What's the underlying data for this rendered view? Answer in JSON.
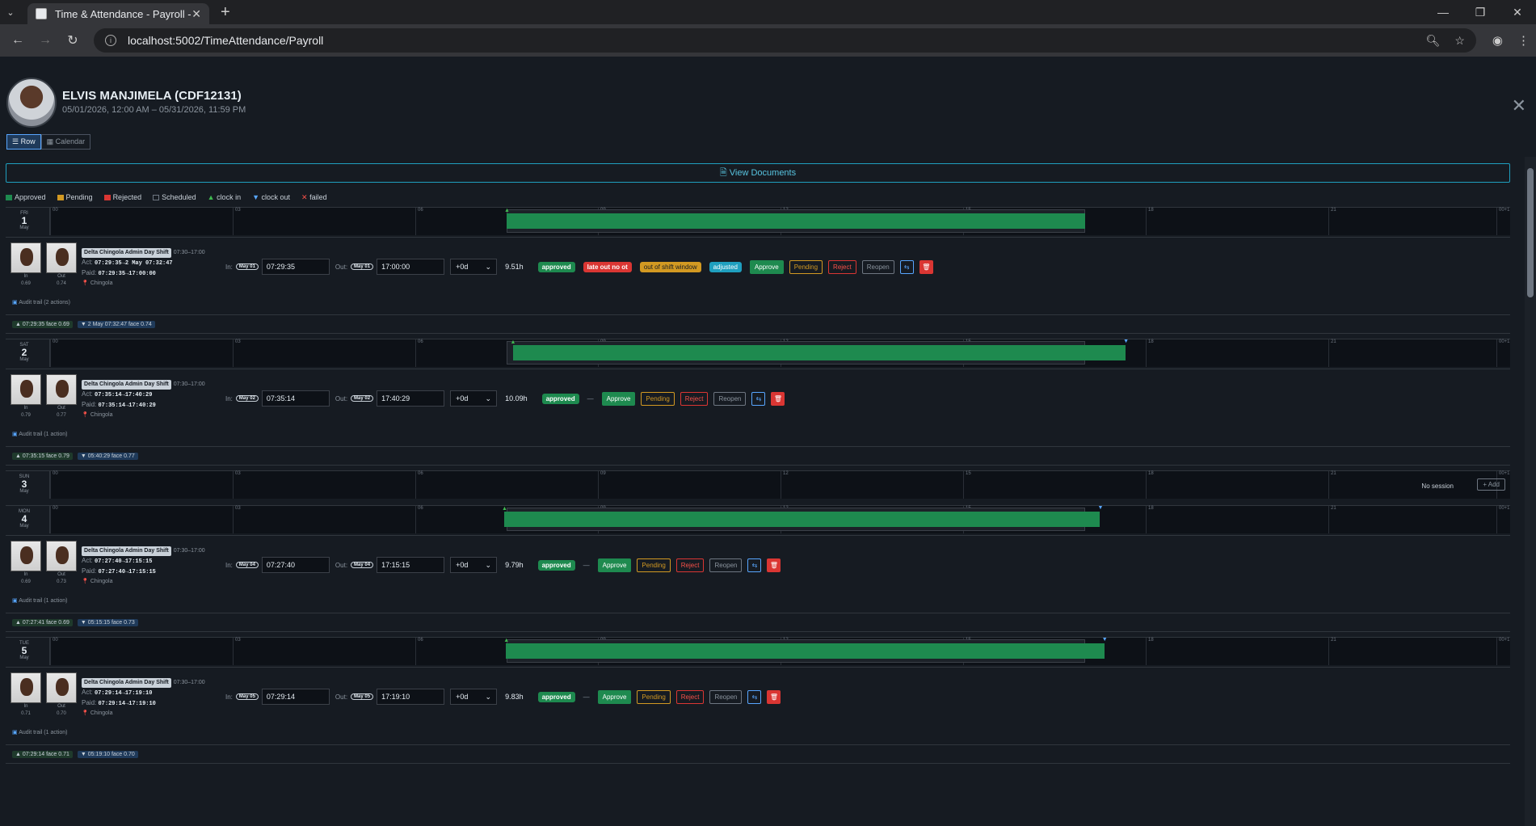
{
  "browser": {
    "tab_title": "Time & Attendance - Payroll - F",
    "url": "localhost:5002/TimeAttendance/Payroll"
  },
  "employee": {
    "name": "ELVIS MANJIMELA (CDF12131)",
    "range": "05/01/2026, 12:00 AM – 05/31/2026, 11:59 PM",
    "view_row": "☰ Row",
    "view_calendar": "▦ Calendar"
  },
  "view_documents": "🗎 View Documents",
  "legend": {
    "approved": "Approved",
    "pending": "Pending",
    "rejected": "Rejected",
    "scheduled": "Scheduled",
    "clock_in": "clock in",
    "clock_out": "clock out",
    "failed": "failed"
  },
  "colors": {
    "approved": "#1e8a4f",
    "pending": "#d29922",
    "rejected": "#da3633",
    "info": "#1f9fbf"
  },
  "ticks": [
    "00",
    "03",
    "06",
    "09",
    "12",
    "15",
    "18",
    "21",
    "00+1"
  ],
  "labels": {
    "in": "In:",
    "out": "Out:",
    "photo_in": "In",
    "photo_out": "Out",
    "approve": "Approve",
    "pending": "Pending",
    "reject": "Reject",
    "reopen": "Reopen",
    "no_session": "No session",
    "add": "+ Add",
    "dash": "—"
  },
  "days": [
    {
      "dow": "FRI",
      "num": "1",
      "mon": "May",
      "shift": "Delta Chingola Admin Day Shift",
      "shift_time": "07:30–17:00",
      "act": "07:29:35→2 May 07:32:47",
      "paid": "07:29:35→17:00:00",
      "location": "Chingola",
      "face_in": "0.69",
      "face_out": "0.74",
      "date_in": "May 01",
      "date_out": "May 01",
      "time_in": "07:29:35",
      "time_out": "17:00:00",
      "offset": "+0d",
      "hours": "9.51h",
      "status": "approved",
      "flags": [
        "late out no ot",
        "out of shift window",
        "adjusted"
      ],
      "audit": "Audit trail (2 actions)",
      "punch_in": "▲ 07:29:35 face 0.69",
      "punch_out": "▼ 2 May 07:32:47 face 0.74",
      "work": [
        7.5,
        17.0
      ],
      "in_mark": 7.5,
      "out_mark": null
    },
    {
      "dow": "SAT",
      "num": "2",
      "mon": "May",
      "shift": "Delta Chingola Admin Day Shift",
      "shift_time": "07:30–17:00",
      "act": "07:35:14→17:40:29",
      "paid": "07:35:14→17:40:29",
      "location": "Chingola",
      "face_in": "0.79",
      "face_out": "0.77",
      "date_in": "May 02",
      "date_out": "May 02",
      "time_in": "07:35:14",
      "time_out": "17:40:29",
      "offset": "+0d",
      "hours": "10.09h",
      "status": "approved",
      "flags": [],
      "audit": "Audit trail (1 action)",
      "punch_in": "▲ 07:35:15 face 0.79",
      "punch_out": "▼ 05:40:29 face 0.77",
      "work": [
        7.6,
        17.67
      ],
      "in_mark": 7.6,
      "out_mark": 17.67
    },
    {
      "dow": "SUN",
      "num": "3",
      "mon": "May",
      "empty": true
    },
    {
      "dow": "MON",
      "num": "4",
      "mon": "May",
      "shift": "Delta Chingola Admin Day Shift",
      "shift_time": "07:30–17:00",
      "act": "07:27:40→17:15:15",
      "paid": "07:27:40→17:15:15",
      "location": "Chingola",
      "face_in": "0.69",
      "face_out": "0.73",
      "date_in": "May 04",
      "date_out": "May 04",
      "time_in": "07:27:40",
      "time_out": "17:15:15",
      "offset": "+0d",
      "hours": "9.79h",
      "status": "approved",
      "flags": [],
      "audit": "Audit trail (1 action)",
      "punch_in": "▲ 07:27:41 face 0.69",
      "punch_out": "▼ 05:15:15 face 0.73",
      "work": [
        7.46,
        17.25
      ],
      "in_mark": 7.46,
      "out_mark": 17.25
    },
    {
      "dow": "TUE",
      "num": "5",
      "mon": "May",
      "shift": "Delta Chingola Admin Day Shift",
      "shift_time": "07:30–17:00",
      "act": "07:29:14→17:19:10",
      "paid": "07:29:14→17:19:10",
      "location": "Chingola",
      "face_in": "0.71",
      "face_out": "0.70",
      "date_in": "May 05",
      "date_out": "May 05",
      "time_in": "07:29:14",
      "time_out": "17:19:10",
      "offset": "+0d",
      "hours": "9.83h",
      "status": "approved",
      "flags": [],
      "audit": "Audit trail (1 action)",
      "punch_in": "▲ 07:29:14 face 0.71",
      "punch_out": "▼ 05:19:10 face 0.70",
      "work": [
        7.49,
        17.32
      ],
      "in_mark": 7.49,
      "out_mark": 17.32
    }
  ]
}
